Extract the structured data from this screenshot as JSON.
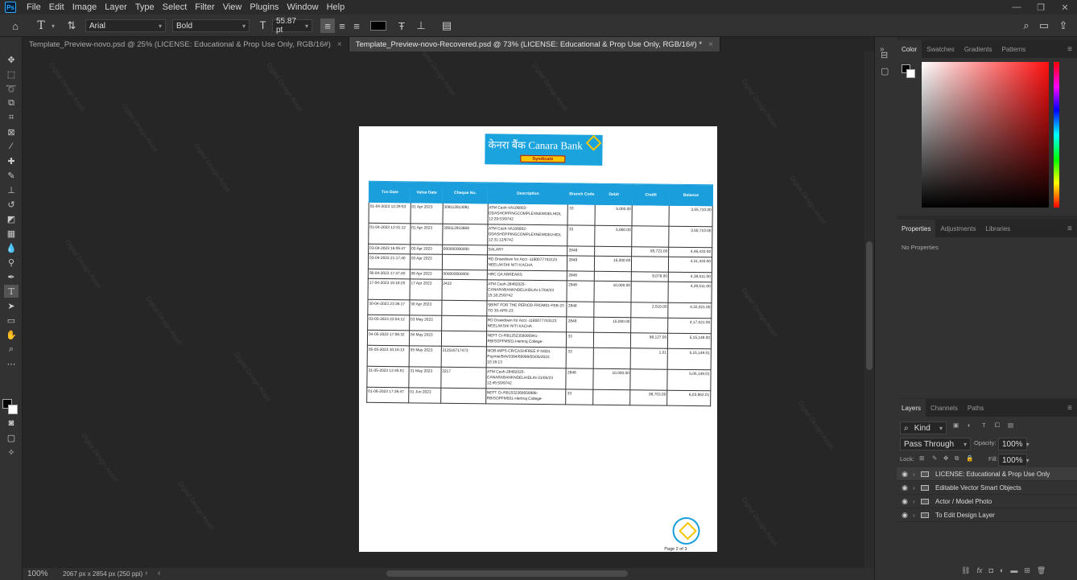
{
  "app": {
    "logo": "Ps"
  },
  "menu": [
    "File",
    "Edit",
    "Image",
    "Layer",
    "Type",
    "Select",
    "Filter",
    "View",
    "Plugins",
    "Window",
    "Help"
  ],
  "options": {
    "font_family": "Arial",
    "font_style": "Bold",
    "font_size": "55.87 pt",
    "text_color": "#000000"
  },
  "tabs": [
    {
      "label": "Template_Preview-novo.psd @ 25% (LICENSE: Educational & Prop Use Only, RGB/16#)",
      "close": "×"
    },
    {
      "label": "Template_Preview-novo-Recovered.psd @ 73% (LICENSE: Educational & Prop Use Only, RGB/16#) *",
      "close": "×"
    }
  ],
  "watermark": "Digital Design Asset",
  "document": {
    "bank_name": "केनरा बैंक  Canara Bank",
    "bank_tag": "Syndicate",
    "page_label": "Page 2 of 3",
    "headers": [
      "Txn Date",
      "Value Date",
      "Cheque No.",
      "Description",
      "Branch Code",
      "Debit",
      "Credit",
      "Balance"
    ],
    "rows": [
      [
        "01-04-2023 12:29:53",
        "01 Apr 2023",
        "309112813081",
        "ATM Cash-VA106802-DDASHOPPINGCOMPLEXNEWDELHIDL 12:29:53/9742",
        "33",
        "5,000.00",
        "",
        "3,55,710.00"
      ],
      [
        "01-04-2023 12:31:12",
        "01 Apr 2023",
        "309112933669",
        "ATM Cash-VA106802-DDASHOPPINGCOMPLEXNEWDELHIDL 12:31:12/9742",
        "33",
        "5,000.00",
        "",
        "3,50,710.00"
      ],
      [
        "03-04-2023 16:05:47",
        "03 Apr 2023",
        "000000000000",
        "SALARY",
        "2848",
        "",
        "95,723.00",
        "4,46,433.00"
      ],
      [
        "03-04-2023 21:17:40",
        "03 Apr 2023",
        "",
        "RD Drawdown for Acct -1180077753123 NEELAKSHI NITI KACHA",
        "2848",
        "15,000.00",
        "",
        "4,31,433.00"
      ],
      [
        "06-04-2023 17:47:40",
        "06 Apr 2023",
        "000000000000",
        "HRC DA ARREARS",
        "2848",
        "",
        "8,078.00",
        "4,39,511.00"
      ],
      [
        "17-04-2023 15:18:25",
        "17 Apr 2023",
        "2422",
        "ATM Cash-28482025-CANARABANKNDELHIDLIN-17/04/23 15:18:25/9742",
        "2848",
        "10,000.00",
        "",
        "4,29,511.00"
      ],
      [
        "30-04-2023 23:36:17",
        "30 Apr 2023",
        "",
        "SBINT FOR THE PERIOD FROM01-FEB-23 TO 30-APR-23",
        "2848",
        "",
        "2,510.00",
        "4,32,021.00"
      ],
      [
        "03-05-2023 23:04:12",
        "03 May 2023",
        "",
        "RD Drawdown for Acct -1180077753123 NEELAKSHI NITI KACHA",
        "2848",
        "15,000.00",
        "",
        "4,17,021.00"
      ],
      [
        "04-05-2023 17:06:32",
        "04 May 2023",
        "",
        "NEFT Cr-RB1252359095941-RBISOPFM501-Hemraj College-",
        "33",
        "",
        "98,127.00",
        "5,15,148.00"
      ],
      [
        "05-05-2023 10:16:13",
        "05 May 2023",
        "312516717473",
        "MOB-IMPS-CR/CASHFREE P NSDL Paymei/BAV0384/69999/05/05/2023 10:16:13",
        "33",
        "",
        "1.01",
        "5,15,149.01"
      ],
      [
        "31-05-2023 12:45:51",
        "31 May 2023",
        "3217",
        "ATM Cash-28482025-CANARABANKNDELHIDLIN-31/05/23 12:45:50/9742",
        "2848",
        "10,000.00",
        "",
        "5,05,149.01"
      ],
      [
        "01-06-2023 17:26:47",
        "01 Jun 2023",
        "",
        "NEFT Cr-RB1532369059986-RBISOPFM501-Hemraj College-",
        "33",
        "",
        "98,703.00",
        "6,03,852.01"
      ]
    ]
  },
  "status": {
    "zoom": "100%",
    "doc_size": "2067 px x 2854 px (250 ppi)"
  },
  "panels": {
    "color_tabs": [
      "Color",
      "Swatches",
      "Gradients",
      "Patterns"
    ],
    "props_tabs": [
      "Properties",
      "Adjustments",
      "Libraries"
    ],
    "props_text": "No Properties",
    "layer_tabs": [
      "Layers",
      "Channels",
      "Paths"
    ],
    "kind": "Kind",
    "blend": "Pass Through",
    "opacity_label": "Opacity:",
    "opacity": "100%",
    "lock_label": "Lock:",
    "fill_label": "Fill:",
    "fill": "100%",
    "layers": [
      "LICENSE: Educational & Prop Use Only",
      "Editable Vector Smart Objects",
      "Actor / Model Photo",
      "To Edit Design Layer"
    ]
  }
}
